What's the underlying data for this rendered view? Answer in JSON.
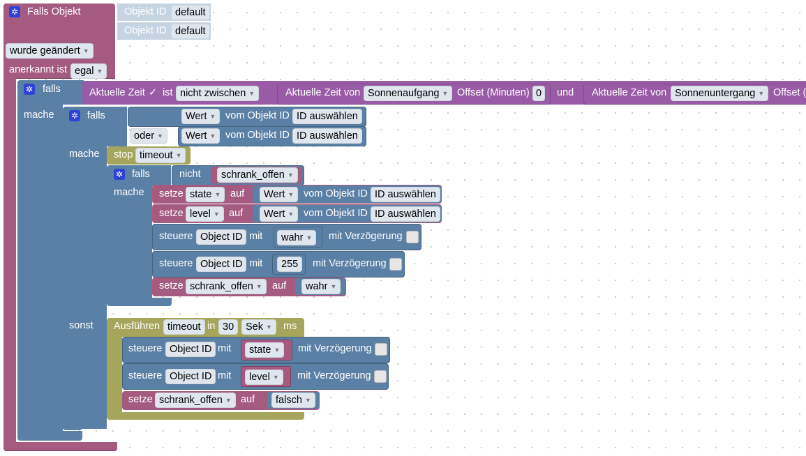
{
  "trigger": {
    "title": "Falls Objekt",
    "object_rows": [
      {
        "label": "Objekt ID",
        "value": "default"
      },
      {
        "label": "Objekt ID",
        "value": "default"
      }
    ],
    "changed_option": "wurde geändert",
    "ack_label": "anerkannt ist",
    "ack_value": "egal"
  },
  "outer_if": {
    "falls": "falls",
    "mache": "mache",
    "time_label": "Aktuelle Zeit",
    "check": "✓",
    "ist": "ist",
    "compare_op": "nicht zwischen",
    "time_from_label": "Aktuelle Zeit von",
    "sunrise": "Sonnenaufgang",
    "offset_label": "Offset (Minuten)",
    "offset_value": "0",
    "und": "und",
    "time_to_label": "Aktuelle Zeit von",
    "sunset": "Sonnenuntergang",
    "offset_label_2": "Offset (Minuten)"
  },
  "inner_if": {
    "falls": "falls",
    "oder": "oder",
    "mache": "mache",
    "sonst": "sonst",
    "cond1": {
      "prop": "Wert",
      "text": "vom Objekt ID",
      "id": "ID auswählen"
    },
    "cond2": {
      "prop": "Wert",
      "text": "vom Objekt ID",
      "id": "ID auswählen"
    }
  },
  "stop_block": {
    "label": "stop",
    "name": "timeout"
  },
  "nested_if": {
    "falls": "falls",
    "nicht": "nicht",
    "var": "schrank_offen",
    "mache": "mache"
  },
  "then_stmts": {
    "set_state": {
      "setze": "setze",
      "var": "state",
      "auf": "auf",
      "prop": "Wert",
      "text": "vom Objekt ID",
      "id": "ID auswählen"
    },
    "set_level": {
      "setze": "setze",
      "var": "level",
      "auf": "auf",
      "prop": "Wert",
      "text": "vom Objekt ID",
      "id": "ID auswählen"
    },
    "ctrl1": {
      "steuere": "steuere",
      "obj": "Object ID",
      "mit": "mit",
      "val": "wahr",
      "delay": "mit Verzögerung"
    },
    "ctrl2": {
      "steuere": "steuere",
      "obj": "Object ID",
      "mit": "mit",
      "val": "255",
      "delay": "mit Verzögerung"
    },
    "set_flag": {
      "setze": "setze",
      "var": "schrank_offen",
      "auf": "auf",
      "val": "wahr"
    }
  },
  "else_stmts": {
    "timeout": {
      "label": "Ausführen",
      "name": "timeout",
      "in": "in",
      "value": "30",
      "unit": "Sek",
      "ms": "ms"
    },
    "ctrl_state": {
      "steuere": "steuere",
      "obj": "Object ID",
      "mit": "mit",
      "val": "state",
      "delay": "mit Verzögerung"
    },
    "ctrl_level": {
      "steuere": "steuere",
      "obj": "Object ID",
      "mit": "mit",
      "val": "level",
      "delay": "mit Verzögerung"
    },
    "set_flag": {
      "setze": "setze",
      "var": "schrank_offen",
      "auf": "auf",
      "val": "falsch"
    }
  },
  "icons": {
    "gear": "gear-icon",
    "dropdown": "dropdown-arrow-icon"
  },
  "colors": {
    "event": "#a55b80",
    "logic": "#5b80a5",
    "time": "#995ba5",
    "timer": "#a5a55b",
    "canvas_dots": "#c9c9c9"
  }
}
